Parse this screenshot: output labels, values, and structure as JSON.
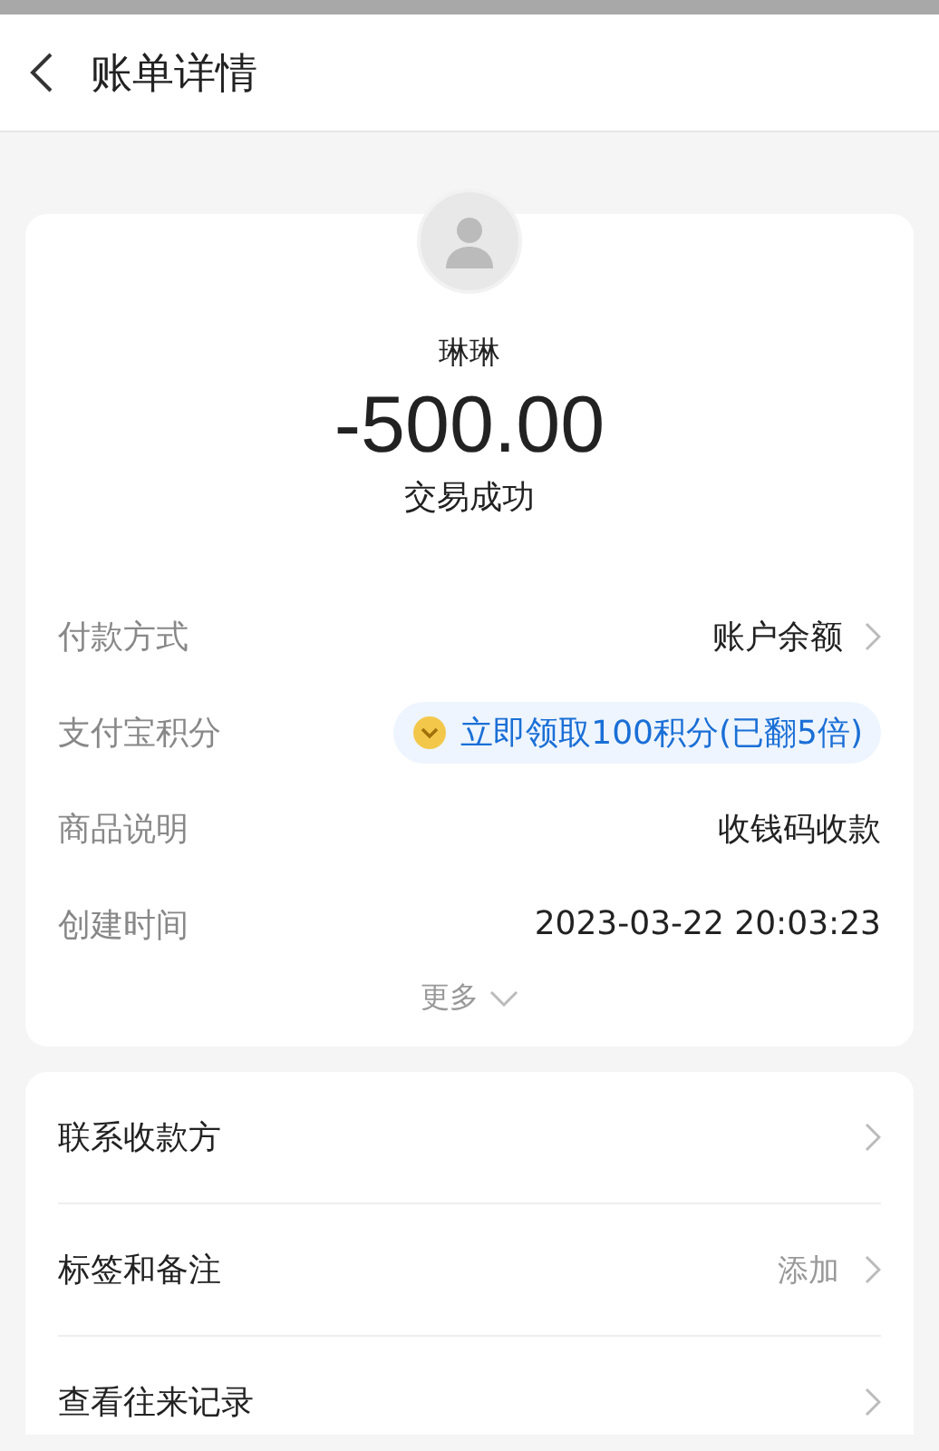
{
  "header": {
    "title": "账单详情"
  },
  "summary": {
    "name": "琳琳",
    "amount": "-500.00",
    "status": "交易成功"
  },
  "details": [
    {
      "kind": "link",
      "label": "付款方式",
      "value": "账户余额"
    },
    {
      "kind": "badge",
      "label": "支付宝积分",
      "value": "立即领取100积分(已翻5倍)"
    },
    {
      "kind": "text",
      "label": "商品说明",
      "value": "收钱码收款"
    },
    {
      "kind": "text",
      "label": "创建时间",
      "value": "2023-03-22 20:03:23"
    }
  ],
  "more": "更多",
  "actions": [
    {
      "label": "联系收款方"
    },
    {
      "label": "标签和备注",
      "value": "添加"
    },
    {
      "label": "查看往来记录"
    }
  ]
}
